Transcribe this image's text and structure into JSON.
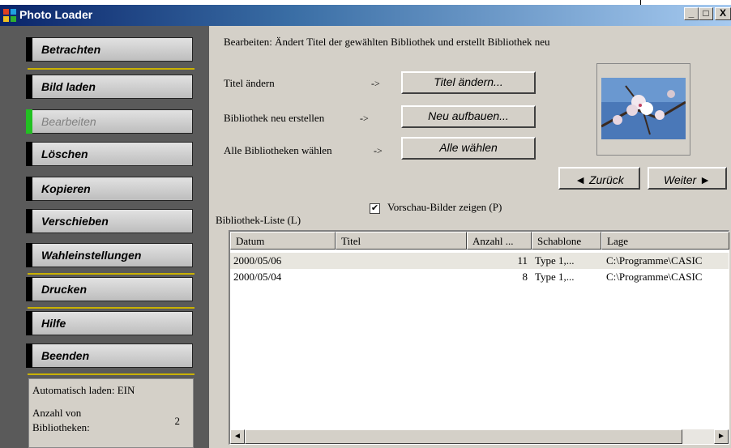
{
  "window": {
    "title": "Photo Loader",
    "minimize_label": "_",
    "maximize_label": "□",
    "close_label": "X"
  },
  "sidebar": {
    "items": [
      {
        "label": "Betrachten",
        "enabled": true
      },
      {
        "label": "Bild laden",
        "enabled": true
      },
      {
        "label": "Bearbeiten",
        "enabled": false
      },
      {
        "label": "Löschen",
        "enabled": true
      },
      {
        "label": "Kopieren",
        "enabled": true
      },
      {
        "label": "Verschieben",
        "enabled": true
      },
      {
        "label": "Wahleinstellungen",
        "enabled": true
      },
      {
        "label": "Drucken",
        "enabled": true
      },
      {
        "label": "Hilfe",
        "enabled": true
      },
      {
        "label": "Beenden",
        "enabled": true
      }
    ],
    "status": {
      "auto_load": "Automatisch laden: EIN",
      "count_label_line1": "Anzahl von",
      "count_label_line2": "Bibliotheken:",
      "count_value": "2"
    }
  },
  "main": {
    "description": "Bearbeiten: Ändert Titel der gewählten Bibliothek und erstellt Bibliothek neu",
    "actions": [
      {
        "label": "Titel ändern",
        "arrow": "->",
        "button": "Titel ändern..."
      },
      {
        "label": "Bibliothek neu erstellen",
        "arrow": "->",
        "button": "Neu aufbauen..."
      },
      {
        "label": "Alle Bibliotheken wählen",
        "arrow": "->",
        "button": "Alle wählen"
      }
    ],
    "preview_checkbox": {
      "label": "Vorschau-Bilder zeigen (P)",
      "checked": true
    },
    "nav": {
      "back": "Zurück",
      "next": "Weiter"
    },
    "list": {
      "label": "Bibliothek-Liste (L)",
      "columns": [
        "Datum",
        "Titel",
        "Anzahl ...",
        "Schablone",
        "Lage"
      ],
      "rows": [
        [
          "2000/05/06",
          "",
          "11",
          "Type 1,...",
          "C:\\Programme\\CASIC"
        ],
        [
          "2000/05/04",
          "",
          "8",
          "Type 1,...",
          "C:\\Programme\\CASIC"
        ]
      ]
    }
  },
  "colors": {
    "sidebar_bg": "#5a5a5a",
    "accent_separator": "#c9b100",
    "active_marker": "#22c022",
    "window_bg": "#d4d0c8"
  }
}
